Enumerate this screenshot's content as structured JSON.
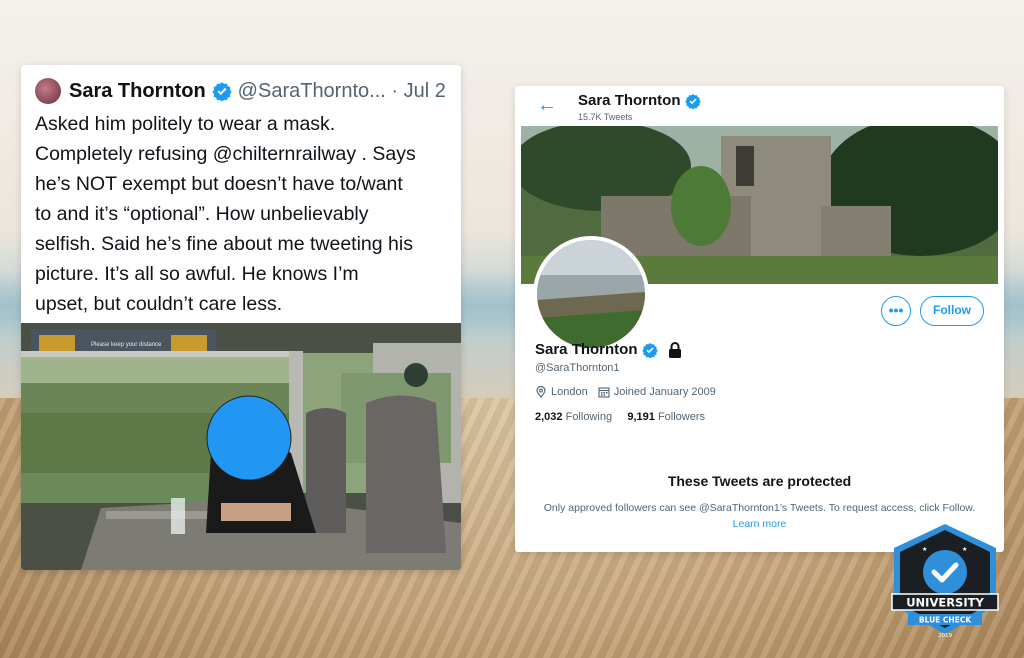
{
  "tweet": {
    "author_name": "Sara Thornton",
    "handle_and_date": "@SaraThornto... · Jul 2",
    "text": "Asked him politely to wear a mask.\nCompletely refusing @chilternrailway . Says\nhe’s NOT exempt but doesn’t have to/want\nto and it’s “optional”. How unbelievably\nselfish. Said he’s fine about me tweeting his\npicture. It’s all so awful. He knows I’m\nupset, but couldn’t care less.",
    "photo_sign_text": "Please keep your distance"
  },
  "profile": {
    "back_icon": "arrow-left-icon",
    "top_name": "Sara Thornton",
    "tweet_count": "15.7K Tweets",
    "more_label": "•••",
    "follow_label": "Follow",
    "name": "Sara Thornton",
    "handle": "@SaraThornton1",
    "location": "London",
    "joined": "Joined January 2009",
    "following_count": "2,032",
    "following_label": "Following",
    "followers_count": "9,191",
    "followers_label": "Followers",
    "protected_title": "These Tweets are protected",
    "protected_body": "Only approved followers can see @SaraThornton1’s Tweets. To request access, click Follow. ",
    "learn_more": "Learn more"
  },
  "badge": {
    "line1": "UNIVERSITY",
    "line2": "BLUE CHECK",
    "year": "2019"
  },
  "colors": {
    "twitter_blue": "#1d9bf0",
    "badge_dark": "#1b1f24",
    "badge_blue": "#2f8fd8"
  }
}
